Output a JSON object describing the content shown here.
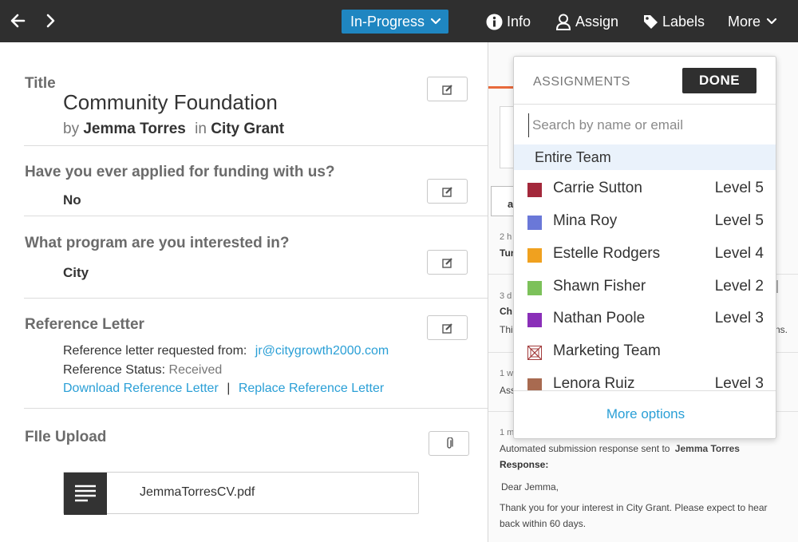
{
  "topbar": {
    "status": "In-Progress",
    "actions": {
      "info": "Info",
      "assign": "Assign",
      "labels": "Labels",
      "more": "More"
    }
  },
  "application": {
    "title_label": "Title",
    "title": "Community Foundation",
    "by_word": "by",
    "applicant": "Jemma Torres",
    "in_word": "in",
    "program": "City Grant",
    "questions": [
      {
        "label": "Have you ever applied for funding with us?",
        "answer": "No"
      },
      {
        "label": "What program are you interested in?",
        "answer": "City"
      }
    ],
    "reference": {
      "label": "Reference Letter",
      "requested_label": "Reference letter requested from:",
      "requested_email": "jr@citygrowth2000.com",
      "status_label": "Reference Status:",
      "status_value": "Received",
      "download_link": "Download Reference Letter",
      "separator": "|",
      "replace_link": "Replace Reference Letter"
    },
    "file_upload": {
      "label": "FIle Upload",
      "file_name": "JemmaTorresCV.pdf"
    }
  },
  "activity": {
    "items": [
      {
        "time": "2 h",
        "text": "Tur"
      },
      {
        "time": "3 d",
        "heading": "Ch",
        "text": "Thi",
        "tail": "ns."
      },
      {
        "time": "1 w",
        "text": "Ass"
      },
      {
        "time": "1 m"
      }
    ],
    "submission_note": "Automated submission response sent to",
    "submission_recipient": "Jemma Torres",
    "response_label": "Response:",
    "greeting": "Dear Jemma,",
    "body": "Thank you for your interest in City Grant. Please expect to hear back within 60 days."
  },
  "assignments": {
    "title": "ASSIGNMENTS",
    "done_label": "DONE",
    "search_placeholder": "Search by name or email",
    "entire_team": "Entire Team",
    "members": [
      {
        "name": "Carrie Sutton",
        "level": "Level 5",
        "color": "#a3283b"
      },
      {
        "name": "Mina Roy",
        "level": "Level 5",
        "color": "#6a78d8"
      },
      {
        "name": "Estelle Rodgers",
        "level": "Level 4",
        "color": "#f0a11f"
      },
      {
        "name": "Shawn Fisher",
        "level": "Level 2",
        "color": "#7cc15a"
      },
      {
        "name": "Nathan Poole",
        "level": "Level 3",
        "color": "#8a2fb8"
      },
      {
        "name": "Marketing Team",
        "level": "",
        "color": "#a33c3c"
      },
      {
        "name": "Lenora Ruiz",
        "level": "Level 3",
        "color": "#a86a50"
      }
    ],
    "more_options": "More options"
  }
}
